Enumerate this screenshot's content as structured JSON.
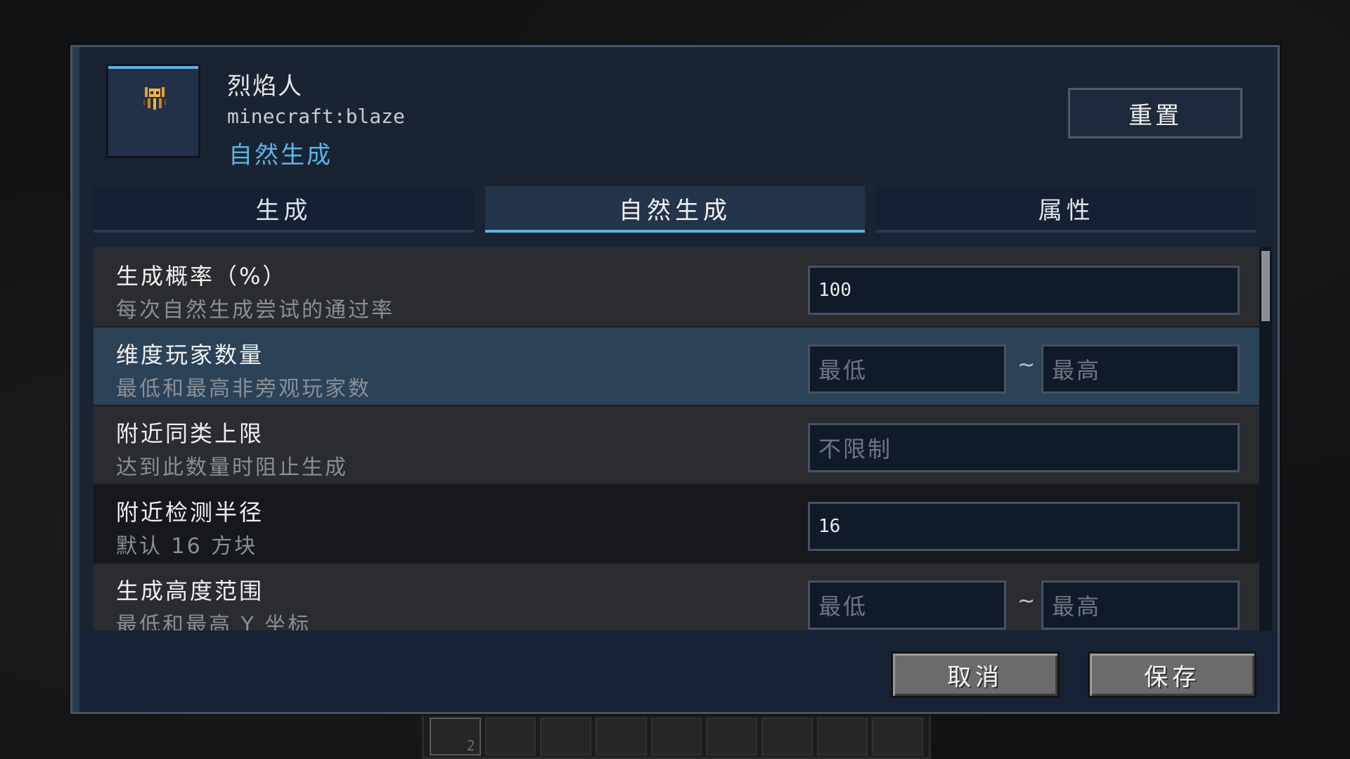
{
  "entity": {
    "name": "烈焰人",
    "id": "minecraft:blaze",
    "category": "自然生成",
    "icon": "blaze-icon"
  },
  "header": {
    "reset_label": "重置"
  },
  "tabs": [
    {
      "label": "生成",
      "active": false
    },
    {
      "label": "自然生成",
      "active": true
    },
    {
      "label": "属性",
      "active": false
    }
  ],
  "settings": [
    {
      "label": "生成概率（%）",
      "desc": "每次自然生成尝试的通过率",
      "value": "100"
    },
    {
      "label": "维度玩家数量",
      "desc": "最低和最高非旁观玩家数",
      "min_placeholder": "最低",
      "max_placeholder": "最高",
      "separator": "~"
    },
    {
      "label": "附近同类上限",
      "desc": "达到此数量时阻止生成",
      "placeholder": "不限制"
    },
    {
      "label": "附近检测半径",
      "desc": "默认 16 方块",
      "value": "16"
    },
    {
      "label": "生成高度范围",
      "desc": "最低和最高 Y 坐标",
      "min_placeholder": "最低",
      "max_placeholder": "最高",
      "separator": "~"
    }
  ],
  "footer": {
    "cancel_label": "取消",
    "save_label": "保存"
  },
  "hotbar": {
    "selected_count": "2"
  },
  "colors": {
    "accent": "#5ab4e6",
    "dialog_bg": "#1a2331",
    "highlight_row": "#2b4257"
  }
}
